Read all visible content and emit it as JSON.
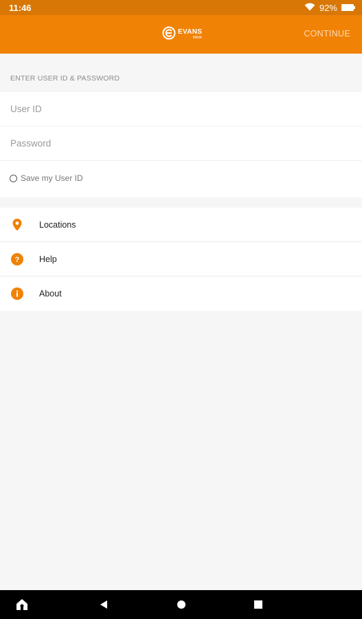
{
  "status_bar": {
    "time": "11:46",
    "battery": "92%",
    "icons": [
      "wifi-icon",
      "battery-icon"
    ]
  },
  "app_bar": {
    "logo": {
      "word": "EVANS",
      "sub": "BANK"
    },
    "continue_label": "CONTINUE"
  },
  "login": {
    "section_header": "ENTER USER ID & PASSWORD",
    "user_id_placeholder": "User ID",
    "password_placeholder": "Password",
    "save_user_id_label": "Save my User ID"
  },
  "menu": {
    "items": [
      {
        "label": "Locations",
        "icon": "location-pin-icon"
      },
      {
        "label": "Help",
        "icon": "help-icon"
      },
      {
        "label": "About",
        "icon": "info-icon"
      }
    ]
  },
  "nav_bar": {
    "icons": [
      "home-icon",
      "back-icon",
      "home-circle-icon",
      "recents-icon"
    ]
  },
  "colors": {
    "accent": "#f08205",
    "status_bar": "#d87706",
    "background": "#f6f6f6"
  }
}
